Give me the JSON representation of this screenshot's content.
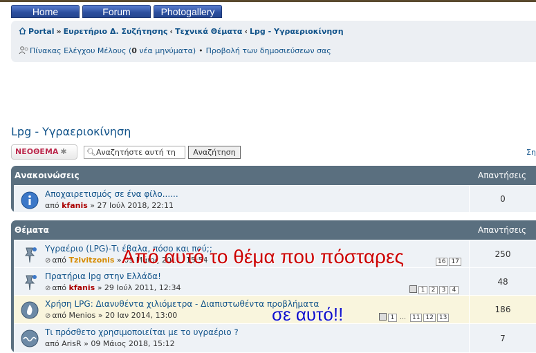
{
  "nav": {
    "home": "Home",
    "forum": "Forum",
    "gallery": "Photogallery"
  },
  "breadcrumb": {
    "items": [
      "Portal",
      "Ευρετήριο Δ. Συζήτησης",
      "Τεχνικά Θέματα",
      "Lpg - Υγραεριοκίνηση"
    ],
    "separators": [
      "»",
      "‹",
      "‹"
    ]
  },
  "ucp": {
    "link": "Πίνακας Ελέγχου Μέλους",
    "new_pm_prefix": "(",
    "new_pm_count": "0",
    "new_pm_suffix": " νέα μηνύματα)",
    "posts_link": "Προβολή των δημοσιεύσεων σας"
  },
  "forum": {
    "title": "Lpg - Υγραεριοκίνηση",
    "newtopic_a": "ΝΕΟ",
    "newtopic_b": "ΘΕΜΑ",
    "search_placeholder": "Αναζητήστε αυτή τη",
    "search_button": "Αναζήτηση",
    "right_cut": "Ση"
  },
  "announcements": {
    "header": "Ανακοινώσεις",
    "replies_label": "Απαντήσεις",
    "rows": [
      {
        "title": "Αποχαιρετισμός σε ένα φίλο......",
        "by": "από",
        "author": "kfanis",
        "date": "» 27 Ιούλ 2018, 22:11",
        "replies": "0"
      }
    ]
  },
  "topics": {
    "header": "Θέματα",
    "replies_label": "Απαντήσεις",
    "rows": [
      {
        "title": "Υγραέριο (LPG)-Τι έβαλα, πόσο και πού;;",
        "by": "από",
        "author": "Tzivitzonis",
        "date": "» 09 Μάιος 2011, 15:54",
        "replies": "250",
        "pages": [
          "16",
          "17"
        ]
      },
      {
        "title": "Πρατήρια lpg στην Ελλάδα!",
        "by": "από",
        "author": "kfanis",
        "date": "» 29 Ιούλ 2011, 12:34",
        "replies": "48",
        "pages": [
          "1",
          "2",
          "3",
          "4"
        ]
      },
      {
        "title": "Χρήση LPG: Διανυθέντα χιλιόμετρα - Διαπιστωθέντα προβλήματα",
        "by": "από",
        "author": "Menios",
        "date": "» 20 Ιαν 2014, 13:00",
        "replies": "186",
        "pages": [
          "1",
          "…",
          "11",
          "12",
          "13"
        ]
      },
      {
        "title": "Τι πρόσθετο χρησιμοποιείται με το υγραέριο ?",
        "by": "από",
        "author": "ArisR",
        "date": "» 09 Μάιος 2018, 15:12",
        "replies": "7",
        "pages": []
      }
    ]
  },
  "annotations": {
    "top": "Από αυτό το θέμα που πόσταρες",
    "bottom": "σε αυτό!!"
  },
  "colors": {
    "link": "#105289",
    "author_red": "#aa0000",
    "author_orange": "#d68b00",
    "panel": "#5a6f7f",
    "annotation_red": "#cc0000",
    "annotation_blue": "#1010cc"
  },
  "icons": {
    "home": "home-icon",
    "ucp": "members-icon",
    "search": "magnifier-icon",
    "info": "info-icon",
    "sticky": "pin-icon",
    "hot": "fire-icon",
    "normal": "wave-icon",
    "attachment": "paperclip-icon"
  }
}
